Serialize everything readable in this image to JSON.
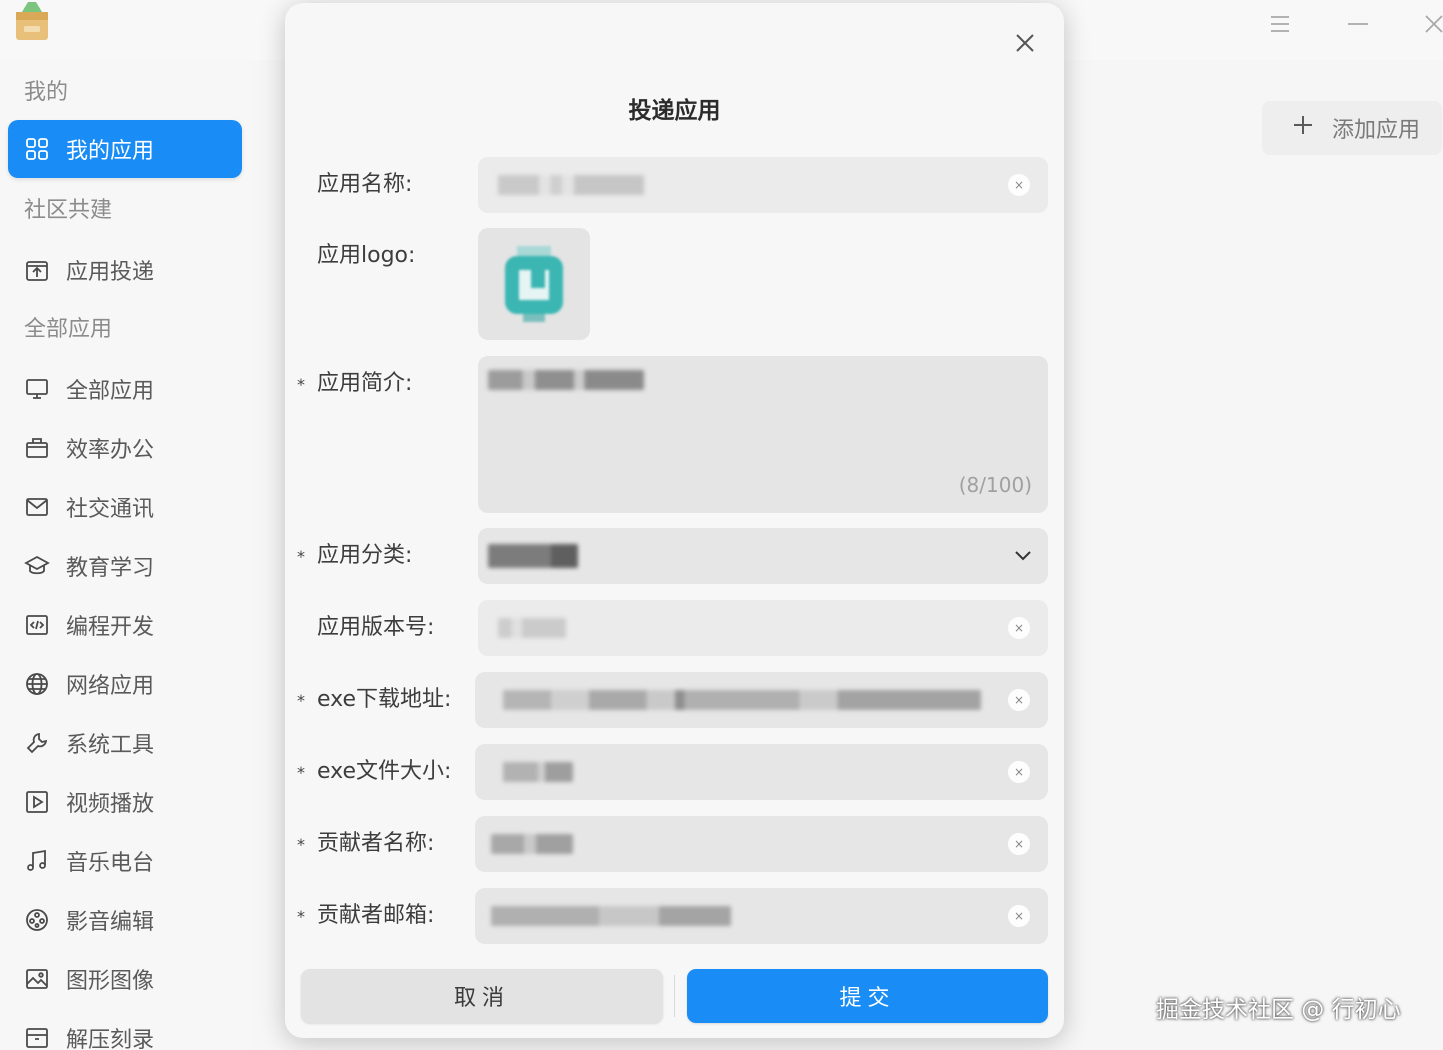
{
  "window": {
    "logo_icon": "package-box-icon",
    "menu_icon": "hamburger-icon",
    "minimize_icon": "minimize-icon",
    "close_icon": "close-icon"
  },
  "sidebar": {
    "section_mine": "我的",
    "my_apps": "我的应用",
    "section_community": "社区共建",
    "app_submit": "应用投递",
    "section_all": "全部应用",
    "items": [
      {
        "label": "全部应用",
        "icon": "monitor-icon"
      },
      {
        "label": "效率办公",
        "icon": "briefcase-icon"
      },
      {
        "label": "社交通讯",
        "icon": "mail-icon"
      },
      {
        "label": "教育学习",
        "icon": "graduation-cap-icon"
      },
      {
        "label": "编程开发",
        "icon": "code-icon"
      },
      {
        "label": "网络应用",
        "icon": "globe-icon"
      },
      {
        "label": "系统工具",
        "icon": "wrench-icon"
      },
      {
        "label": "视频播放",
        "icon": "play-icon"
      },
      {
        "label": "音乐电台",
        "icon": "music-note-icon"
      },
      {
        "label": "影音编辑",
        "icon": "film-reel-icon"
      },
      {
        "label": "图形图像",
        "icon": "image-icon"
      },
      {
        "label": "解压刻录",
        "icon": "archive-icon"
      }
    ]
  },
  "page": {
    "add_app_label": "添加应用",
    "watermark": "掘金技术社区 @ 行初心"
  },
  "modal": {
    "title": "投递应用",
    "labels": {
      "app_name": "应用名称:",
      "app_logo": "应用logo:",
      "app_intro": "应用简介:",
      "app_category": "应用分类:",
      "app_version": "应用版本号:",
      "exe_url": "exe下载地址:",
      "exe_size": "exe文件大小:",
      "contributor_name": "贡献者名称:",
      "contributor_email": "贡献者邮箱:"
    },
    "required_mark": "*",
    "intro_counter": "(8/100)",
    "cancel_label": "取消",
    "submit_label": "提交",
    "colors": {
      "accent": "#1a8cf5",
      "field_bg": "#ebebeb"
    }
  }
}
